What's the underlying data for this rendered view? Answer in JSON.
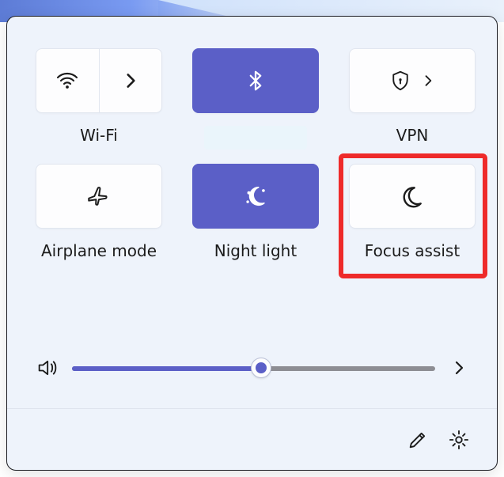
{
  "tiles": {
    "wifi": {
      "label": "Wi-Fi",
      "active": false
    },
    "bluetooth": {
      "label": "",
      "active": true
    },
    "vpn": {
      "label": "VPN",
      "active": false
    },
    "airplane": {
      "label": "Airplane mode",
      "active": false
    },
    "nightlight": {
      "label": "Night light",
      "active": true
    },
    "focusassist": {
      "label": "Focus assist",
      "active": false
    }
  },
  "volume": {
    "percent": 52
  },
  "highlight_target": "focusassist",
  "colors": {
    "accent": "#5b5fc7",
    "highlight": "#ee2a2a"
  }
}
